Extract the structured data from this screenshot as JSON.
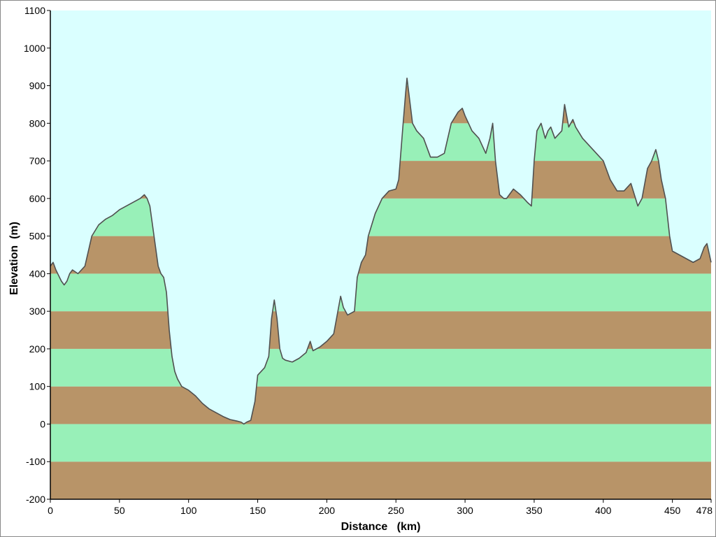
{
  "chart_data": {
    "type": "area",
    "xlabel": "Distance   (km)",
    "ylabel": "Elevation  (m)",
    "xlim": [
      0,
      478
    ],
    "ylim": [
      -200,
      1100
    ],
    "x_ticks": [
      0,
      50,
      100,
      150,
      200,
      250,
      300,
      350,
      400,
      450,
      478
    ],
    "y_ticks": [
      -200,
      -100,
      0,
      100,
      200,
      300,
      400,
      500,
      600,
      700,
      800,
      900,
      1000,
      1100
    ],
    "band_interval": 100,
    "grid": false,
    "legend": "none",
    "colors": {
      "sky": "#daffff",
      "band_light": "#98f0b8",
      "band_dark": "#b89468",
      "line": "#505050"
    },
    "series": [
      {
        "x": [
          0,
          2,
          4,
          6,
          8,
          10,
          12,
          14,
          16,
          20,
          25,
          30,
          35,
          40,
          45,
          50,
          55,
          60,
          65,
          68,
          70,
          72,
          75,
          78,
          80,
          82,
          84,
          86,
          88,
          90,
          92,
          95,
          100,
          105,
          110,
          115,
          120,
          125,
          130,
          135,
          138,
          140,
          142,
          145,
          148,
          150,
          155,
          158,
          160,
          162,
          164,
          166,
          168,
          170,
          175,
          180,
          185,
          188,
          190,
          195,
          200,
          205,
          208,
          210,
          212,
          215,
          220,
          222,
          225,
          228,
          230,
          235,
          240,
          245,
          250,
          252,
          255,
          257,
          258,
          260,
          262,
          265,
          270,
          275,
          280,
          285,
          290,
          295,
          298,
          300,
          305,
          310,
          315,
          318,
          320,
          322,
          325,
          328,
          330,
          335,
          340,
          345,
          348,
          350,
          352,
          355,
          358,
          360,
          362,
          365,
          370,
          372,
          375,
          378,
          380,
          385,
          390,
          395,
          400,
          405,
          410,
          415,
          420,
          425,
          428,
          430,
          432,
          435,
          438,
          440,
          442,
          445,
          448,
          450,
          455,
          460,
          465,
          470,
          473,
          475,
          478
        ],
        "y": [
          420,
          430,
          410,
          395,
          380,
          370,
          380,
          400,
          410,
          400,
          420,
          500,
          530,
          545,
          555,
          570,
          580,
          590,
          600,
          610,
          600,
          580,
          500,
          420,
          400,
          390,
          350,
          250,
          180,
          140,
          120,
          100,
          90,
          75,
          55,
          40,
          30,
          20,
          12,
          8,
          5,
          0,
          5,
          10,
          60,
          130,
          150,
          180,
          280,
          330,
          280,
          200,
          175,
          170,
          165,
          175,
          190,
          220,
          195,
          205,
          220,
          240,
          300,
          340,
          310,
          290,
          300,
          390,
          430,
          450,
          500,
          560,
          600,
          620,
          625,
          650,
          790,
          880,
          920,
          860,
          800,
          780,
          760,
          710,
          710,
          720,
          800,
          830,
          840,
          820,
          780,
          760,
          720,
          760,
          800,
          700,
          610,
          600,
          600,
          625,
          610,
          590,
          580,
          700,
          780,
          800,
          760,
          780,
          790,
          760,
          780,
          850,
          790,
          810,
          790,
          760,
          740,
          720,
          700,
          650,
          620,
          620,
          640,
          580,
          600,
          640,
          680,
          700,
          730,
          700,
          650,
          600,
          500,
          460,
          450,
          440,
          430,
          440,
          470,
          480,
          430
        ]
      }
    ]
  }
}
